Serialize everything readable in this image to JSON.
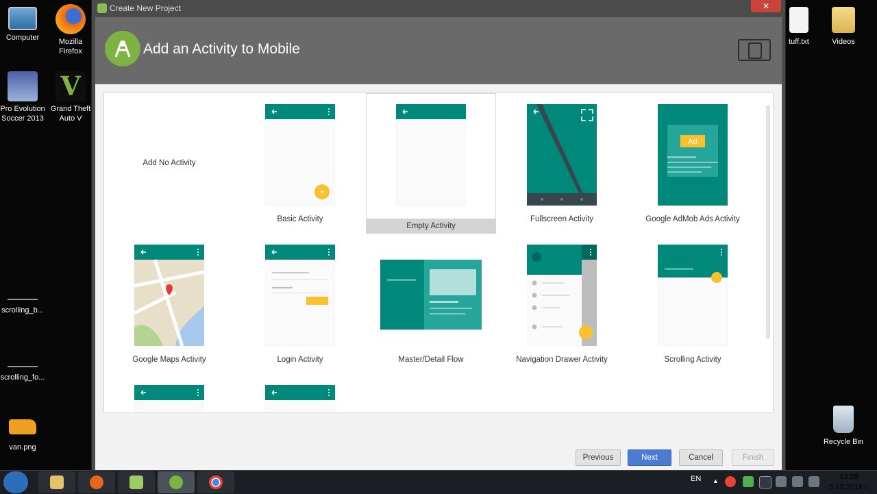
{
  "desktop": {
    "icons": [
      {
        "name": "Computer"
      },
      {
        "name": "Mozilla Firefox"
      },
      {
        "name": "Pro Evolution Soccer 2013"
      },
      {
        "name": "Grand Theft Auto V"
      },
      {
        "name": "scrolling_b..."
      },
      {
        "name": "scrolling_fo..."
      },
      {
        "name": "van.png"
      },
      {
        "name": "tuff.txt"
      },
      {
        "name": "Videos"
      },
      {
        "name": "Recycle Bin"
      }
    ]
  },
  "window": {
    "title": "Create New Project",
    "heading": "Add an Activity to Mobile",
    "close_label": "✕"
  },
  "gallery": {
    "no_activity_label": "Add No Activity",
    "activities": [
      {
        "label": "Basic Activity"
      },
      {
        "label": "Empty Activity",
        "selected": true
      },
      {
        "label": "Fullscreen Activity"
      },
      {
        "label": "Google AdMob Ads Activity",
        "ad_text": "Ad"
      },
      {
        "label": "Google Maps Activity"
      },
      {
        "label": "Login Activity"
      },
      {
        "label": "Master/Detail Flow"
      },
      {
        "label": "Navigation Drawer Activity"
      },
      {
        "label": "Scrolling Activity"
      }
    ]
  },
  "buttons": {
    "previous": "Previous",
    "next": "Next",
    "cancel": "Cancel",
    "finish": "Finish"
  },
  "taskbar": {
    "language": "EN",
    "time": "13:05",
    "date": "5.12.2016 г."
  },
  "colors": {
    "teal": "#00897b",
    "teal_light": "#26a69a",
    "accent_yellow": "#fbc02d",
    "next_button": "#4a7cd1",
    "android_green": "#7cb342"
  }
}
